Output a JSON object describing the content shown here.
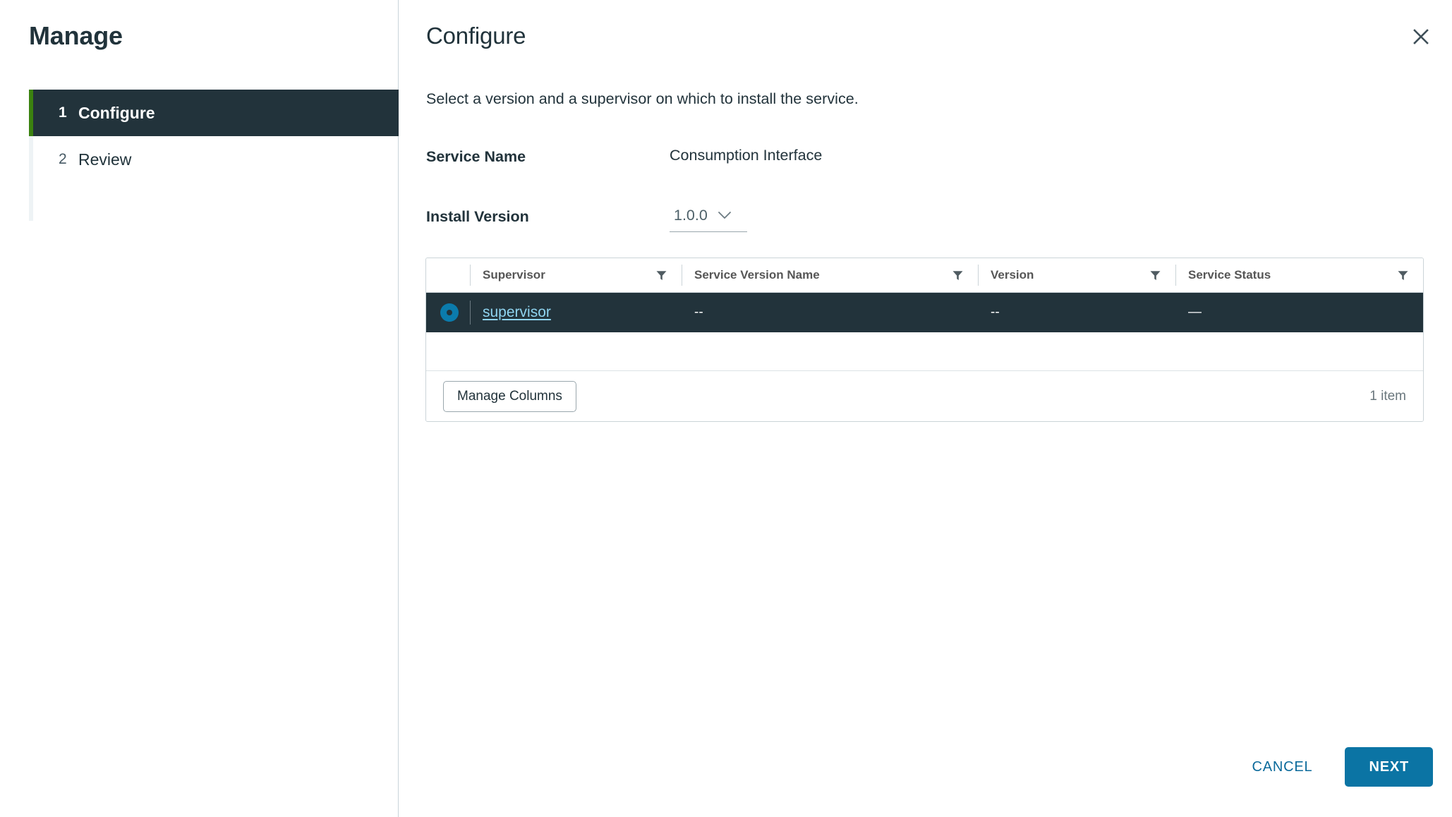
{
  "sidebar": {
    "title": "Manage",
    "steps": [
      {
        "num": "1",
        "label": "Configure",
        "active": true
      },
      {
        "num": "2",
        "label": "Review",
        "active": false
      }
    ]
  },
  "panel": {
    "title": "Configure",
    "description": "Select a version and a supervisor on which to install the service.",
    "close_icon": "close-icon"
  },
  "form": {
    "service_name_label": "Service Name",
    "service_name_value": "Consumption Interface",
    "install_version_label": "Install Version",
    "install_version_value": "1.0.0",
    "install_version_options": [
      "1.0.0"
    ]
  },
  "grid": {
    "columns": [
      {
        "key": "radio",
        "label": ""
      },
      {
        "key": "supervisor",
        "label": "Supervisor",
        "filter_icon": "filter-icon"
      },
      {
        "key": "service_version_name",
        "label": "Service Version Name",
        "filter_icon": "filter-icon"
      },
      {
        "key": "version",
        "label": "Version",
        "filter_icon": "filter-icon"
      },
      {
        "key": "service_status",
        "label": "Service Status",
        "filter_icon": "filter-icon"
      }
    ],
    "rows": [
      {
        "selected": true,
        "supervisor": "supervisor",
        "service_version_name": "--",
        "version": "--",
        "service_status": "—"
      }
    ],
    "manage_columns_label": "Manage Columns",
    "item_count": "1 item"
  },
  "actions": {
    "cancel_label": "CANCEL",
    "next_label": "NEXT"
  },
  "colors": {
    "accent_blue": "#0b74a4",
    "step_active_bg": "#22333b",
    "step_rail_green": "#3b8210",
    "link_blue": "#8fd4f0"
  }
}
